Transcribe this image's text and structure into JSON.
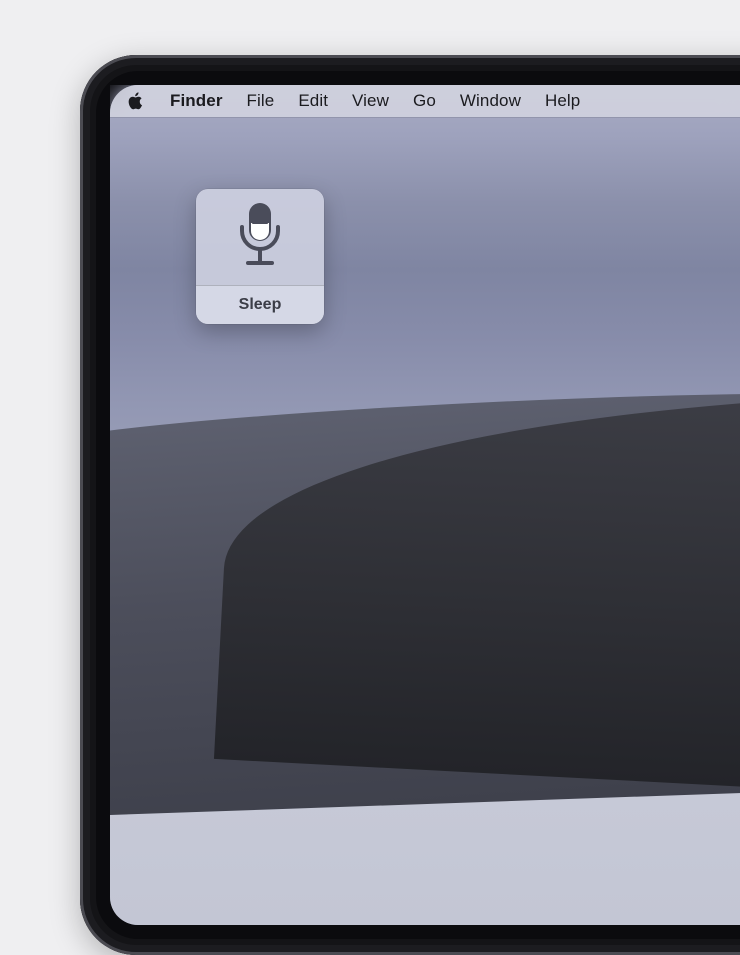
{
  "menuBar": {
    "appName": "Finder",
    "items": [
      "File",
      "Edit",
      "View",
      "Go",
      "Window",
      "Help"
    ]
  },
  "voiceControl": {
    "status": "Sleep"
  }
}
